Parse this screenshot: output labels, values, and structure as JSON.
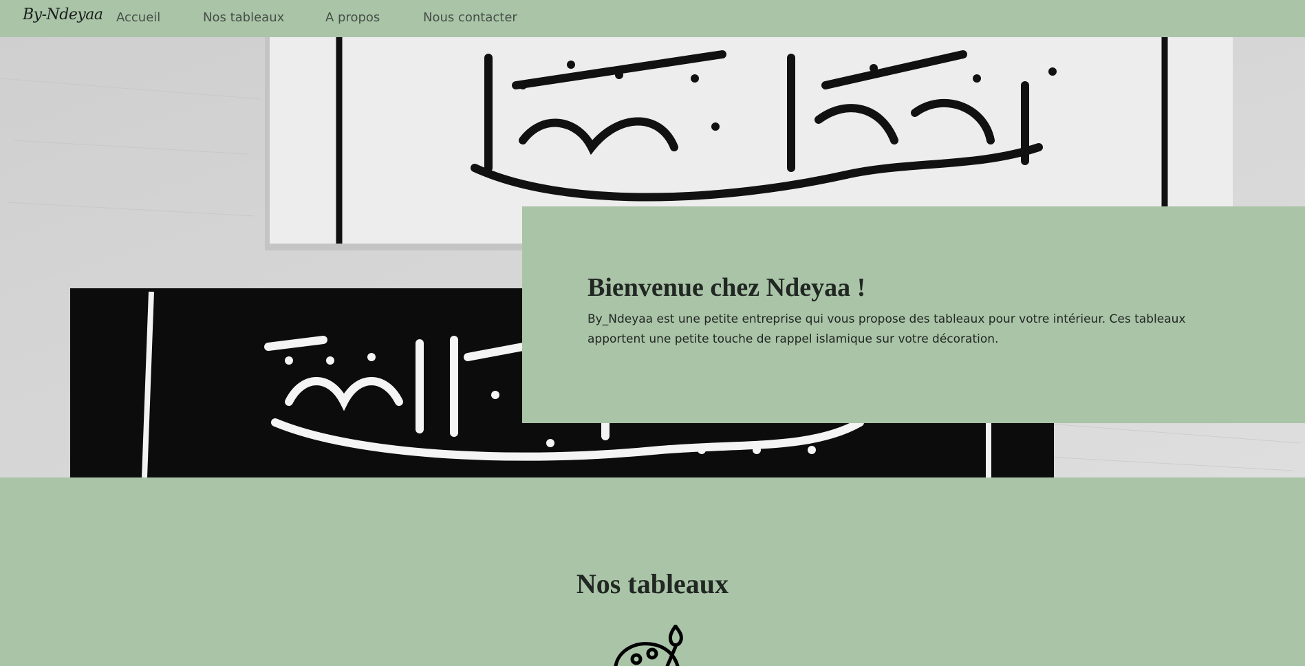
{
  "navbar": {
    "brand": "By-Ndeyaa",
    "links": [
      "Accueil",
      "Nos tableaux",
      "A propos",
      "Nous contacter"
    ]
  },
  "hero": {
    "image": "calligraphy-canvases-photo",
    "welcome_title": "Bienvenue chez Ndeyaa !",
    "welcome_text": "By_Ndeyaa est une petite entreprise qui vous propose des tableaux pour votre intérieur. Ces tableaux apportent une petite touche de rappel islamique sur votre décoration."
  },
  "gallery": {
    "title": "Nos tableaux",
    "icon": "palette-icon"
  },
  "colors": {
    "accent_green": "#aac4a8",
    "text_dark": "#212722",
    "nav_text": "#454f46"
  }
}
